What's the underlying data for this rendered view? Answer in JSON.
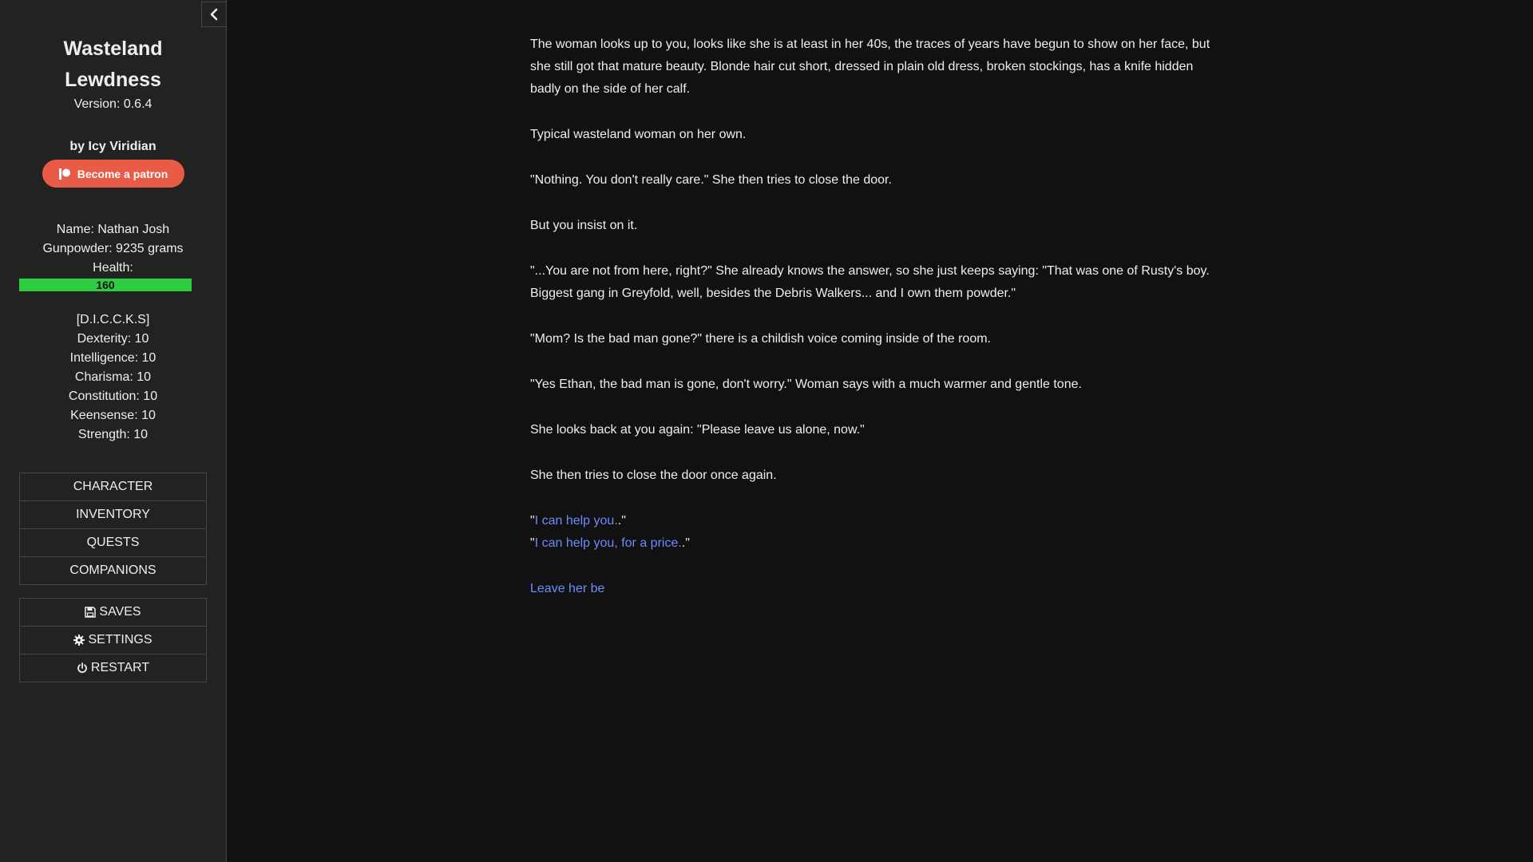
{
  "sidebar": {
    "title_line1": "Wasteland",
    "title_line2": "Lewdness",
    "version": "Version: 0.6.4",
    "author": "by Icy Viridian",
    "patron_button": "Become a patron",
    "character": {
      "name": "Name: Nathan Josh",
      "gunpowder": "Gunpowder: 9235 grams",
      "health_label": "Health:",
      "health_value": "160",
      "health_fraction": 1.0
    },
    "stats": {
      "header": "[D.I.C.C.K.S]",
      "dexterity": "Dexterity: 10",
      "intelligence": "Intelligence: 10",
      "charisma": "Charisma: 10",
      "constitution": "Constitution: 10",
      "keensense": "Keensense: 10",
      "strength": "Strength: 10"
    },
    "menu_story": [
      "CHARACTER",
      "INVENTORY",
      "QUESTS",
      "COMPANIONS"
    ],
    "menu_core": [
      "SAVES",
      "SETTINGS",
      "RESTART"
    ]
  },
  "passage": {
    "p1": "The woman looks up to you, looks like she is at least in her 40s, the traces of years have begun to show on her face, but she still got that mature beauty. Blonde hair cut short, dressed in plain old dress, broken stockings, has a knife hidden badly on the side of her calf.",
    "p2": "Typical wasteland woman on her own.",
    "p3": "\"Nothing. You don't really care.\" She then tries to close the door.",
    "p4": "But you insist on it.",
    "p5": "\"...You are not from here, right?\" She already knows the answer, so she just keeps saying: \"That was one of Rusty's boy. Biggest gang in Greyfold, well, besides the Debris Walkers... and I own them powder.\"",
    "p6": "\"Mom? Is the bad man gone?\" there is a childish voice coming inside of the room.",
    "p7": "\"Yes Ethan, the bad man is gone, don't worry.\" Woman says with a much warmer and gentle tone.",
    "p8": "She looks back at you again: \"Please leave us alone, now.\"",
    "p9": "She then tries to close the door once again.",
    "choice1_link": "I can help you.",
    "choice2_link": "I can help you, for a price.",
    "quote_open": "\"",
    "quote_close": ".\"",
    "leave_link": "Leave her be"
  },
  "colors": {
    "background": "#111111",
    "sidebar": "#222222",
    "link": "#6b8cff",
    "patron": "#e85b46",
    "health": "#2ecc40"
  }
}
